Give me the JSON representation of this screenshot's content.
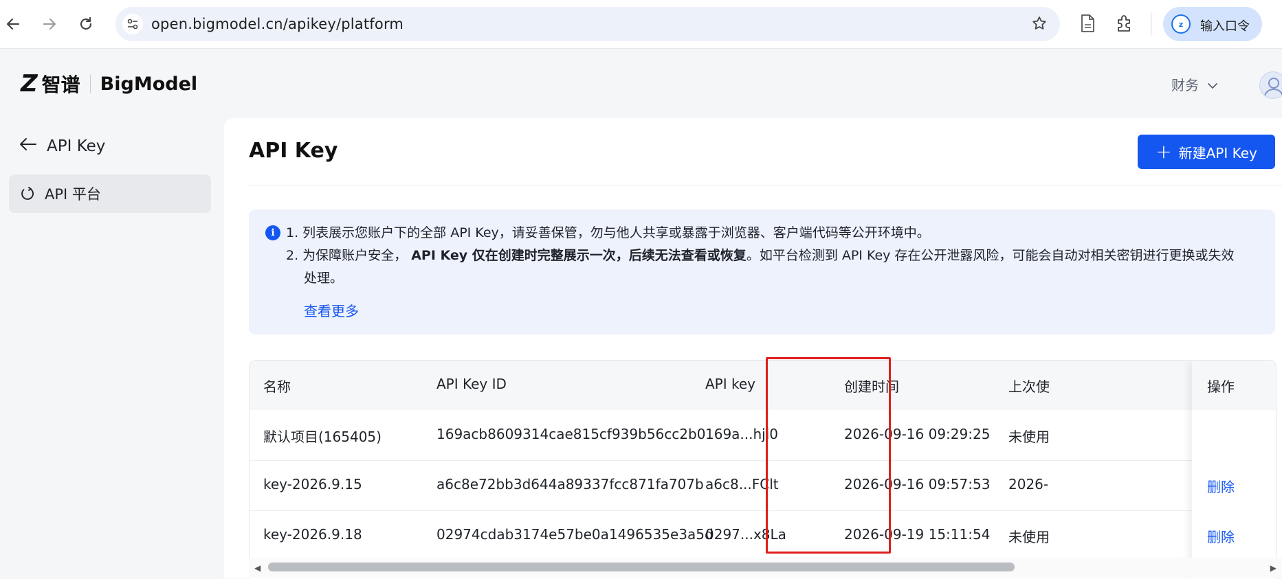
{
  "browser": {
    "url": "open.bigmodel.cn/apikey/platform",
    "profile_label": "输入口令",
    "profile_initial": "z"
  },
  "header": {
    "brand_zh": "智谱",
    "brand_en": "BigModel",
    "finance_menu": "财务"
  },
  "sidebar": {
    "back_label": "API Key",
    "items": [
      {
        "label": "API 平台"
      }
    ]
  },
  "main": {
    "title": "API Key",
    "new_button": "新建API Key",
    "notice": {
      "line1": "1. 列表展示您账户下的全部 API Key，请妥善保管，勿与他人共享或暴露于浏览器、客户端代码等公开环境中。",
      "line2_prefix": "2. 为保障账户安全，",
      "line2_bold": "API Key 仅在创建时完整展示一次，后续无法查看或恢复",
      "line2_suffix": "。如平台检测到 API Key 存在公开泄露风险，可能会自动对相关密钥进行更换或失效",
      "line3": "处理。",
      "more_link": "查看更多"
    },
    "table": {
      "columns": [
        "名称",
        "API Key ID",
        "API key",
        "创建时间",
        "上次使",
        "操作"
      ],
      "rows": [
        {
          "name": "默认项目(165405)",
          "id": "169acb8609314cae815cf939b56cc2b0",
          "key": "169a...hji0",
          "created": "2026-09-16 09:29:25",
          "last_used": "未使用",
          "action": ""
        },
        {
          "name": "key-2026.9.15",
          "id": "a6c8e72bb3d644a89337fcc871fa707b",
          "key": "a6c8...FClt",
          "created": "2026-09-16 09:57:53",
          "last_used": "2026-",
          "action": "删除"
        },
        {
          "name": "key-2026.9.18",
          "id": "02974cdab3174e57be0a1496535e3a5d",
          "key": "0297...x8La",
          "created": "2026-09-19 15:11:54",
          "last_used": "未使用",
          "action": "删除"
        }
      ]
    }
  },
  "colors": {
    "accent": "#1456f0",
    "highlight_box": "#e11d1d"
  }
}
